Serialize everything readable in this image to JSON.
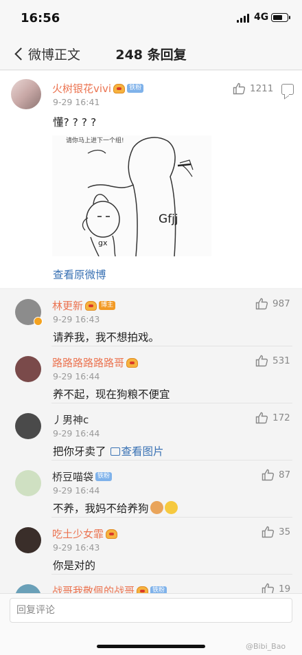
{
  "status_bar": {
    "time": "16:56",
    "network": "4G",
    "battery_level": 0.72
  },
  "nav": {
    "back_label": "微博正文",
    "title": "248 条回复"
  },
  "main_comment": {
    "username": "火树银花vivi",
    "badge": "铁粉",
    "time": "9-29 16:41",
    "likes": "1211",
    "text": "懂? ? ? ?",
    "image": {
      "top_caption": "请你马上进下一个组!",
      "label_large": "Gfjj",
      "label_small": "gx"
    },
    "view_original": "查看原微博"
  },
  "replies": [
    {
      "username": "林更新",
      "badge": "博主",
      "badge_kind": "host",
      "crown": true,
      "time": "9-29 16:43",
      "likes": "987",
      "text": "请养我，我不想拍戏。",
      "avatar_color": "#8c8c8c",
      "verified": true,
      "name_color": "#eb7350"
    },
    {
      "username": "路路路路路路哥",
      "crown": true,
      "time": "9-29 16:44",
      "likes": "531",
      "text": "养不起，现在狗粮不便宜",
      "avatar_color": "#7a4a4a",
      "name_color": "#eb7350"
    },
    {
      "username": "丿男神c",
      "time": "9-29 16:44",
      "likes": "172",
      "text": "把你牙卖了",
      "link": "查看图片",
      "avatar_color": "#4a4a4a",
      "name_color": "#333333"
    },
    {
      "username": "桥豆喵袋",
      "badge": "铁粉",
      "badge_kind": "fan",
      "time": "9-29 16:44",
      "likes": "87",
      "text": "不养，我妈不给养狗",
      "avatar_color": "#cfe0c2",
      "emojis": [
        "dog-face",
        "smiling-face"
      ],
      "name_color": "#333333"
    },
    {
      "username": "吃土少女霏",
      "crown": true,
      "time": "9-29 16:43",
      "likes": "35",
      "text": "你是对的",
      "avatar_color": "#3a2e2a",
      "name_color": "#eb7350"
    },
    {
      "username": "战哥我敬佩的战哥",
      "badge": "铁粉",
      "badge_kind": "fan",
      "crown": true,
      "time": "",
      "likes": "19",
      "text": "",
      "avatar_color": "#6aa0b8",
      "name_color": "#eb7350"
    }
  ],
  "reply_input": {
    "placeholder": "回复评论"
  },
  "watermark": "@Bibi_Bao",
  "colors": {
    "accent_name": "#eb7350",
    "link": "#3a72b4",
    "fan_badge": "#7fb2ea",
    "host_badge": "#f29a26"
  }
}
